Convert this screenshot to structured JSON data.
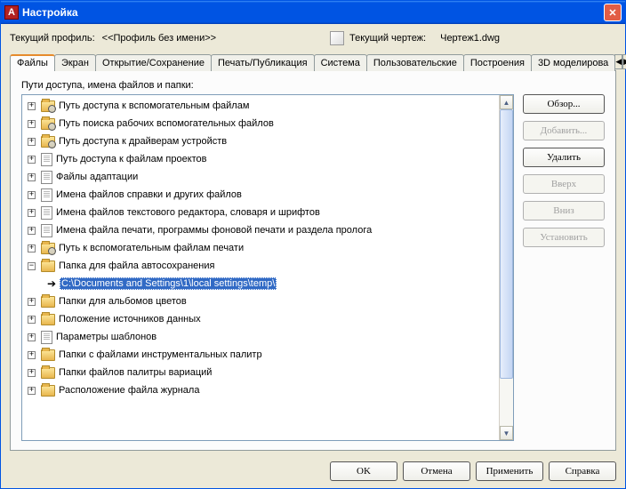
{
  "window": {
    "title": "Настройка"
  },
  "info": {
    "profile_label": "Текущий профиль:",
    "profile_value": "<<Профиль без имени>>",
    "drawing_label": "Текущий чертеж:",
    "drawing_value": "Чертеж1.dwg"
  },
  "tabs": {
    "files": "Файлы",
    "screen": "Экран",
    "opensave": "Открытие/Сохранение",
    "print": "Печать/Публикация",
    "system": "Система",
    "user": "Пользовательские",
    "build": "Построения",
    "model3d": "3D моделирова"
  },
  "section_label": "Пути доступа, имена файлов и папки:",
  "side_buttons": {
    "browse": "Обзор...",
    "add": "Добавить...",
    "delete": "Удалить",
    "up": "Вверх",
    "down": "Вниз",
    "set": "Установить"
  },
  "bottom_buttons": {
    "ok": "OK",
    "cancel": "Отмена",
    "apply": "Применить",
    "help": "Справка"
  },
  "tree": [
    {
      "label": "Путь доступа к вспомогательным файлам",
      "icon": "folder-mag",
      "exp": "+"
    },
    {
      "label": "Путь поиска рабочих вспомогательных файлов",
      "icon": "folder-mag",
      "exp": "+"
    },
    {
      "label": "Путь доступа к драйверам устройств",
      "icon": "folder-mag",
      "exp": "+"
    },
    {
      "label": "Путь доступа к файлам проектов",
      "icon": "doc",
      "exp": "+"
    },
    {
      "label": "Файлы адаптации",
      "icon": "doc",
      "exp": "+"
    },
    {
      "label": "Имена файлов справки и других файлов",
      "icon": "doc",
      "exp": "+"
    },
    {
      "label": "Имена файлов текстового редактора, словаря и шрифтов",
      "icon": "doc",
      "exp": "+"
    },
    {
      "label": "Имена файла печати, программы фоновой печати и раздела пролога",
      "icon": "doc",
      "exp": "+"
    },
    {
      "label": "Путь к вспомогательным файлам печати",
      "icon": "folder-mag",
      "exp": "+"
    },
    {
      "label": "Папка для файла автосохранения",
      "icon": "folder",
      "exp": "-"
    },
    {
      "label": "C:\\Documents and Settings\\1\\local settings\\temp\\",
      "icon": "path",
      "exp": "",
      "child": true,
      "selected": true
    },
    {
      "label": "Папки для альбомов цветов",
      "icon": "folder",
      "exp": "+"
    },
    {
      "label": "Положение источников данных",
      "icon": "folder",
      "exp": "+"
    },
    {
      "label": "Параметры шаблонов",
      "icon": "doc",
      "exp": "+"
    },
    {
      "label": "Папки с файлами инструментальных палитр",
      "icon": "folder",
      "exp": "+"
    },
    {
      "label": "Папки файлов палитры вариаций",
      "icon": "folder",
      "exp": "+"
    },
    {
      "label": "Расположение файла журнала",
      "icon": "folder",
      "exp": "+"
    }
  ]
}
